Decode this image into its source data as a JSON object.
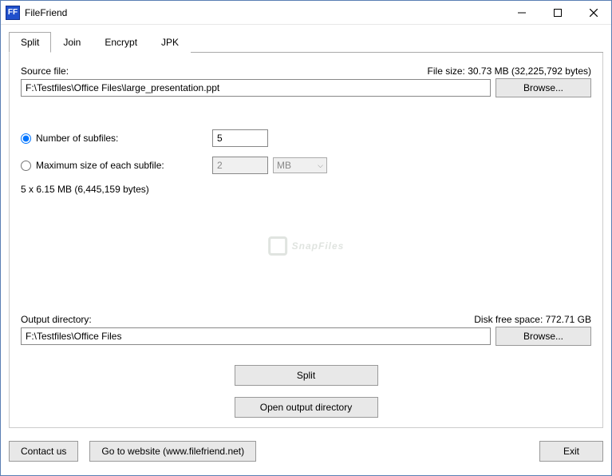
{
  "window": {
    "app_icon_text": "FF",
    "title": "FileFriend"
  },
  "tabs": {
    "split": "Split",
    "join": "Join",
    "encrypt": "Encrypt",
    "jpk": "JPK"
  },
  "source": {
    "label": "Source file:",
    "filesize_label": "File size: 30.73 MB (32,225,792 bytes)",
    "value": "F:\\Testfiles\\Office Files\\large_presentation.ppt",
    "browse": "Browse..."
  },
  "options": {
    "num_subfiles_label": "Number of subfiles:",
    "num_subfiles_value": "5",
    "max_size_label": "Maximum size of each subfile:",
    "max_size_value": "2",
    "max_size_unit": "MB",
    "calc_result": "5 x 6.15 MB (6,445,159 bytes)"
  },
  "watermark": "SnapFiles",
  "output": {
    "label": "Output directory:",
    "diskspace_label": "Disk free space: 772.71 GB",
    "value": "F:\\Testfiles\\Office Files",
    "browse": "Browse..."
  },
  "actions": {
    "split": "Split",
    "open_output": "Open output directory"
  },
  "footer": {
    "contact": "Contact us",
    "website": "Go to website (www.filefriend.net)",
    "exit": "Exit"
  }
}
